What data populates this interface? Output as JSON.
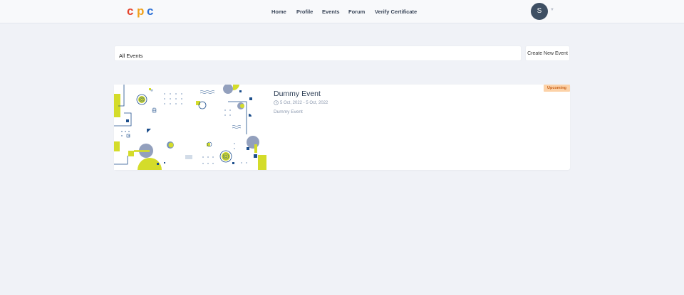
{
  "brand": {
    "logo_text": "cpc",
    "colors": [
      "#e5432b",
      "#f0a11b",
      "#2a6fd6"
    ]
  },
  "nav": {
    "items": [
      {
        "label": "Home"
      },
      {
        "label": "Profile"
      },
      {
        "label": "Events"
      },
      {
        "label": "Forum"
      },
      {
        "label": "Verify Certificate"
      }
    ]
  },
  "user": {
    "initial": "S"
  },
  "toolbar": {
    "search_value": "All Events",
    "create_label": "Create New Event"
  },
  "events": [
    {
      "title": "Dummy Event",
      "date_range": "5 Oct, 2022 - 5 Oct, 2022",
      "description": "Dummy Event",
      "status": "Upcoming"
    }
  ],
  "colors": {
    "accent_yellow": "#d4dc2a",
    "accent_navy": "#1e4f8c",
    "accent_grey_blue": "#93a0bd",
    "badge_bg": "#fcd2a8",
    "badge_text": "#c9621b"
  }
}
